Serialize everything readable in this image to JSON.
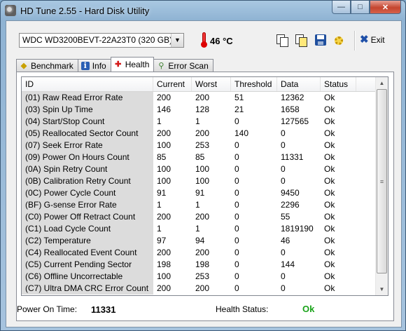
{
  "window": {
    "title": "HD Tune 2.55 - Hard Disk Utility"
  },
  "toolbar": {
    "drive": "WDC WD3200BEVT-22A23T0 (320 GB)",
    "temperature": "46 °C",
    "exit_label": "Exit"
  },
  "tabs": [
    {
      "label": "Benchmark",
      "icon": "benchmark-icon",
      "active": false
    },
    {
      "label": "Info",
      "icon": "info-icon",
      "active": false
    },
    {
      "label": "Health",
      "icon": "health-icon",
      "active": true
    },
    {
      "label": "Error Scan",
      "icon": "error-scan-icon",
      "active": false
    }
  ],
  "table": {
    "columns": [
      "ID",
      "Current",
      "Worst",
      "Threshold",
      "Data",
      "Status"
    ],
    "rows": [
      [
        "(01) Raw Read Error Rate",
        "200",
        "200",
        "51",
        "12362",
        "Ok"
      ],
      [
        "(03) Spin Up Time",
        "146",
        "128",
        "21",
        "1658",
        "Ok"
      ],
      [
        "(04) Start/Stop Count",
        "1",
        "1",
        "0",
        "127565",
        "Ok"
      ],
      [
        "(05) Reallocated Sector Count",
        "200",
        "200",
        "140",
        "0",
        "Ok"
      ],
      [
        "(07) Seek Error Rate",
        "100",
        "253",
        "0",
        "0",
        "Ok"
      ],
      [
        "(09) Power On Hours Count",
        "85",
        "85",
        "0",
        "11331",
        "Ok"
      ],
      [
        "(0A) Spin Retry Count",
        "100",
        "100",
        "0",
        "0",
        "Ok"
      ],
      [
        "(0B) Calibration Retry Count",
        "100",
        "100",
        "0",
        "0",
        "Ok"
      ],
      [
        "(0C) Power Cycle Count",
        "91",
        "91",
        "0",
        "9450",
        "Ok"
      ],
      [
        "(BF) G-sense Error Rate",
        "1",
        "1",
        "0",
        "2296",
        "Ok"
      ],
      [
        "(C0) Power Off Retract Count",
        "200",
        "200",
        "0",
        "55",
        "Ok"
      ],
      [
        "(C1) Load Cycle Count",
        "1",
        "1",
        "0",
        "1819190",
        "Ok"
      ],
      [
        "(C2) Temperature",
        "97",
        "94",
        "0",
        "46",
        "Ok"
      ],
      [
        "(C4) Reallocated Event Count",
        "200",
        "200",
        "0",
        "0",
        "Ok"
      ],
      [
        "(C5) Current Pending Sector",
        "198",
        "198",
        "0",
        "144",
        "Ok"
      ],
      [
        "(C6) Offline Uncorrectable",
        "100",
        "253",
        "0",
        "0",
        "Ok"
      ],
      [
        "(C7) Ultra DMA CRC Error Count",
        "200",
        "200",
        "0",
        "0",
        "Ok"
      ]
    ]
  },
  "footer": {
    "power_on_label": "Power On Time:",
    "power_on_value": "11331",
    "health_label": "Health Status:",
    "health_value": "Ok"
  },
  "colors": {
    "health_ok": "#1aa31a",
    "title_bar": "#8fb3d3"
  }
}
